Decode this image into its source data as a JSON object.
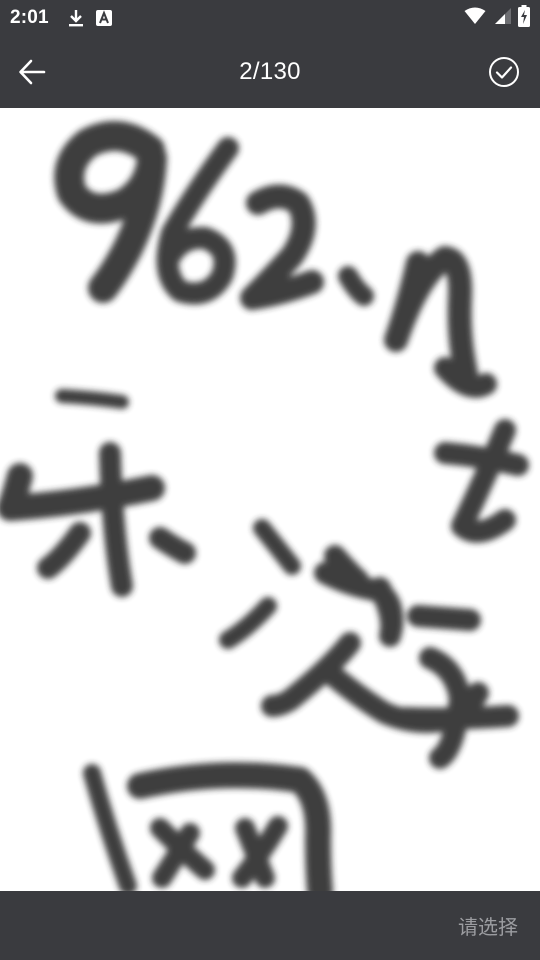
{
  "status_bar": {
    "time": "2:01",
    "icons": [
      "download-icon",
      "font-a-icon",
      "wifi-icon",
      "signal-icon",
      "battery-charging-icon"
    ]
  },
  "header": {
    "back_icon": "arrow-left-icon",
    "title": "2/130",
    "confirm_icon": "check-circle-icon"
  },
  "footer": {
    "select_label": "请选择"
  },
  "colors": {
    "bar_background": "#3a3b3f",
    "canvas_background": "#ffffff",
    "ink": "#2d2d2d",
    "disabled_text": "#9c9da1"
  }
}
